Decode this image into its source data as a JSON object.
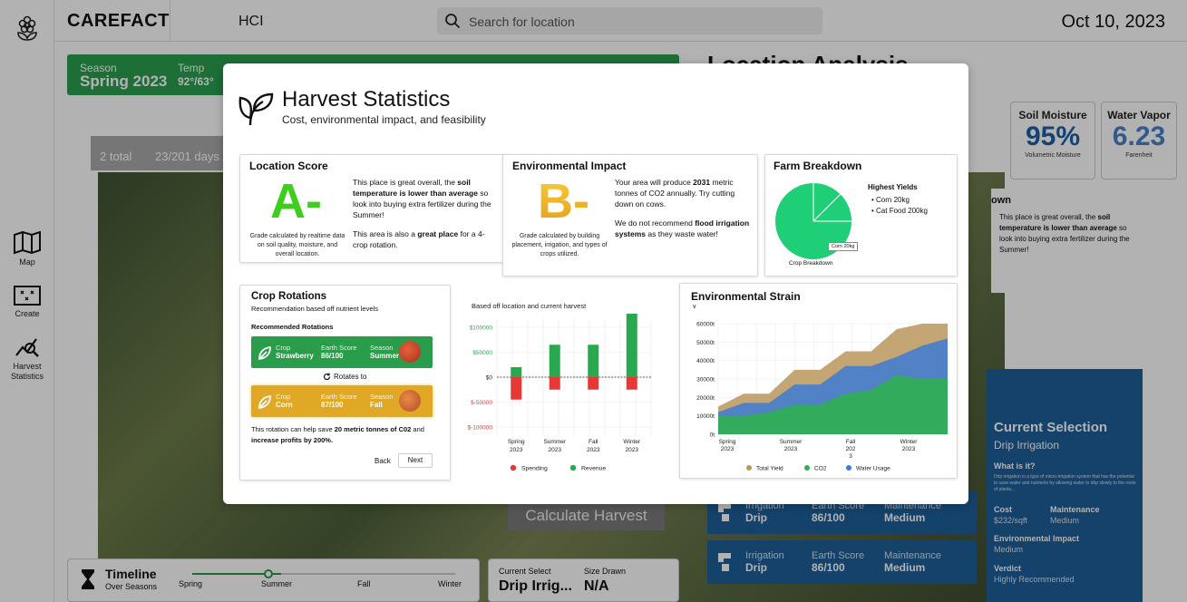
{
  "brand": "CAREFACT",
  "org": "HCI",
  "search": {
    "placeholder": "Search for location"
  },
  "date": "Oct 10, 2023",
  "sidebar": {
    "items": [
      {
        "label": "Map"
      },
      {
        "label": "Create"
      },
      {
        "label": "Harvest Statistics"
      }
    ]
  },
  "season_bar": {
    "season_label": "Season",
    "season": "Spring 2023",
    "temp_label": "Temp",
    "temp": "92°/63°"
  },
  "plots": {
    "count": "2 total",
    "harvest": "23/201 days"
  },
  "location_analysis": {
    "title": "Location Analysis"
  },
  "metrics": [
    {
      "label": "Soil Moisture",
      "value": "95%",
      "sub": "Volumetric Moisture"
    },
    {
      "label": "Water Vapor",
      "value": "6.23",
      "sub": "Farenheit"
    }
  ],
  "bg_breakdown": {
    "heading": "own",
    "text_pre": "This place is great overall, the ",
    "text_bold": "soil temperature is lower than average",
    "text_post": " so look into buying extra fertilizer during the Summer!"
  },
  "bg_rows": [
    {
      "l1": "Irrigation",
      "v1": "Drip",
      "l2": "Earth Score",
      "v2": "86/100",
      "l3": "Maintenance",
      "v3": "Medium"
    },
    {
      "l1": "Irrigation",
      "v1": "Drip",
      "l2": "Earth Score",
      "v2": "86/100",
      "l3": "Maintenance",
      "v3": "Medium"
    }
  ],
  "current_selection": {
    "title": "Current Selection",
    "subtitle": "Drip Irrigation",
    "what": "What is it?",
    "desc": "Drip irrigation is a type of micro-irrigation system that has the potential to save water and nutrients by allowing water to drip slowly to the roots of plants...",
    "cost_l": "Cost",
    "cost_v": "$232/sqft",
    "maint_l": "Maintenance",
    "maint_v": "Medium",
    "env_l": "Environmental Impact",
    "env_v": "Medium",
    "verdict_l": "Verdict",
    "verdict_v": "Highly Recommended"
  },
  "calc_button": "Calculate Harvest",
  "timeline": {
    "title": "Timeline",
    "sub": "Over Seasons",
    "seasons": [
      "Spring",
      "Summer",
      "Fall",
      "Winter"
    ]
  },
  "bottom_selection": {
    "label": "Current Select",
    "value": "Drip Irrig...",
    "size_label": "Size Drawn",
    "size_value": "N/A"
  },
  "modal": {
    "title": "Harvest Statistics",
    "subtitle": "Cost, environmental impact, and feasibility",
    "location_score": {
      "title": "Location Score",
      "grade": "A-",
      "grade_note": "Grade calculated by realtime data on soil quality, moisture, and overall location.",
      "p1_pre": "This place is great overall, the ",
      "p1_b1": "soil",
      "p1_mid": " ",
      "p1_b2": "temperature is lower than average",
      "p1_post": " so look into buying extra fertilizer during the Summer!",
      "p2_pre": "This area is also a ",
      "p2_b": "great place",
      "p2_post": " for a 4-crop rotation."
    },
    "env_impact": {
      "title": "Environmental Impact",
      "grade": "B-",
      "grade_note": "Grade calculated by building placement, irrigation, and types of crops utilized.",
      "p1_pre": "Your area will produce ",
      "p1_b": "2031",
      "p1_post": " metric tonnes of CO2 annually. Try cutting down on cows.",
      "p2_pre": "We do not recommend ",
      "p2_b": "flood irrigation systems",
      "p2_post": " as they waste water!"
    },
    "farm": {
      "title": "Farm Breakdown",
      "caption": "Crop Breakdown",
      "tooltip": "Corn 20kg",
      "yields_title": "Highest Yields",
      "yields": [
        "Corn 20kg",
        "Cat Food 200kg"
      ]
    },
    "rotations": {
      "title": "Crop Rotations",
      "sub": "Recommendation based off nutrient levels",
      "heading": "Recommended Rotations",
      "items": [
        {
          "crop_l": "Crop",
          "crop": "Strawberry",
          "earth_l": "Earth Score",
          "earth": "86/100",
          "season_l": "Season",
          "season": "Summer",
          "color": "#2a9d4a"
        },
        {
          "crop_l": "Crop",
          "crop": "Corn",
          "earth_l": "Earth Score",
          "earth": "87/100",
          "season_l": "Season",
          "season": "Fall",
          "color": "#e0a825"
        }
      ],
      "rotates": "Rotates to",
      "save_pre": "This rotation can help save ",
      "save_b1": "20 metric tonnes of C02",
      "save_mid": " and ",
      "save_b2": "increase profits by 200%.",
      "back": "Back",
      "next": "Next"
    },
    "finance": {
      "sub": "Based off location and current harvest"
    },
    "strain": {
      "title": "Environmental Strain",
      "ylabel": "v",
      "legend": [
        "Total Yield",
        "CO2",
        "Water Usage"
      ]
    }
  },
  "chart_data": [
    {
      "type": "bar",
      "categories": [
        "Spring 2023",
        "Summer 2023",
        "Fall 2023",
        "Winter 2023"
      ],
      "series": [
        {
          "name": "Spending",
          "values": [
            -45000,
            -25000,
            -25000,
            -25000
          ],
          "color": "#e53935"
        },
        {
          "name": "Revenue",
          "values": [
            20000,
            65000,
            65000,
            130000
          ],
          "color": "#2aa84f"
        }
      ],
      "yticks": [
        "$100000",
        "$50000",
        "$0",
        "$-50000",
        "$-100000"
      ],
      "ylim": [
        -100000,
        100000
      ]
    },
    {
      "type": "area",
      "categories": [
        "Spring 2023",
        "Summer 2023",
        "Fall 2023",
        "Winter 2023"
      ],
      "x_labels": [
        "Spring\n2023",
        "Summer\n2023",
        "Fall\n202\n3",
        "Winter\n2023"
      ],
      "yticks": [
        "60000t",
        "50000t",
        "40000t",
        "30000t",
        "20000t",
        "10000t",
        "0t"
      ],
      "ylim": [
        0,
        60000
      ],
      "series": [
        {
          "name": "Total Yield",
          "color": "#b8975a",
          "values": [
            15000,
            22000,
            22000,
            35000,
            35000,
            45000,
            45000,
            57000,
            60000,
            60000
          ]
        },
        {
          "name": "Water Usage",
          "color": "#3d7bd4",
          "values": [
            12000,
            17000,
            17000,
            27000,
            27000,
            37000,
            37000,
            42000,
            48000,
            52000
          ]
        },
        {
          "name": "CO2",
          "color": "#2db34a",
          "values": [
            10000,
            10000,
            12000,
            16000,
            16000,
            22000,
            24000,
            32000,
            30000,
            30000
          ]
        }
      ]
    }
  ]
}
